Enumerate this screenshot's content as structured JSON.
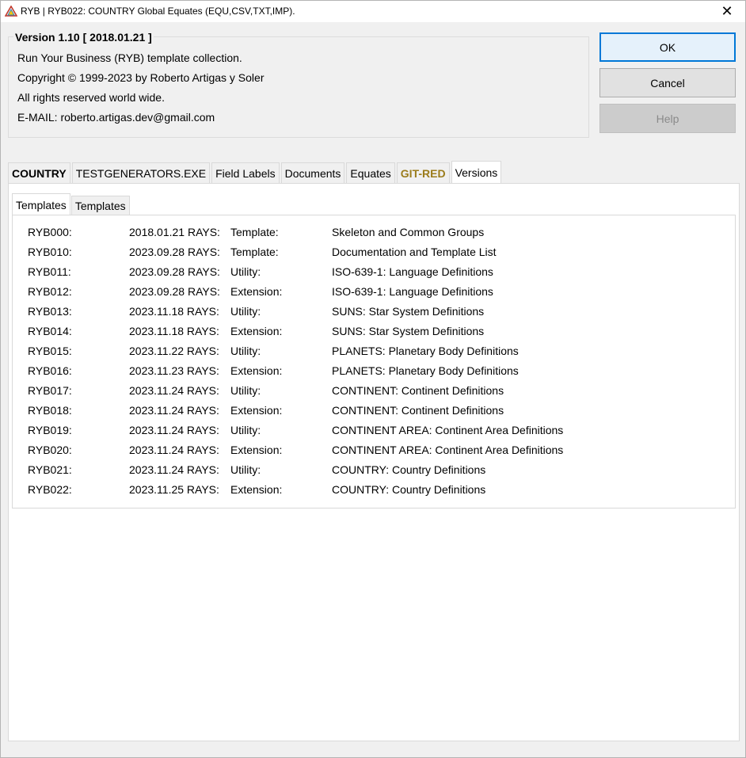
{
  "window": {
    "title": "RYB | RYB022: COUNTRY Global Equates (EQU,CSV,TXT,IMP).",
    "close_label": "✕"
  },
  "info": {
    "caption": "Version 1.10 [ 2018.01.21 ]",
    "lines": [
      "Run Your Business (RYB) template collection.",
      "Copyright © 1999-2023 by Roberto Artigas y Soler",
      "All rights reserved world wide.",
      "E-MAIL: roberto.artigas.dev@gmail.com"
    ]
  },
  "buttons": {
    "ok": "OK",
    "cancel": "Cancel",
    "help": "Help"
  },
  "tabs": [
    {
      "label": "COUNTRY"
    },
    {
      "label": "TESTGENERATORS.EXE"
    },
    {
      "label": "Field Labels"
    },
    {
      "label": "Documents"
    },
    {
      "label": "Equates"
    },
    {
      "label": "GIT-RED"
    },
    {
      "label": "Versions"
    }
  ],
  "subtabs": [
    {
      "label": "Templates"
    },
    {
      "label": "Templates"
    }
  ],
  "versions": [
    {
      "id": "RYB000:",
      "date": "2018.01.21 RAYS:",
      "type": "Template:",
      "desc": "Skeleton and Common Groups"
    },
    {
      "id": "RYB010:",
      "date": "2023.09.28 RAYS:",
      "type": "Template:",
      "desc": "Documentation and Template List"
    },
    {
      "id": "RYB011:",
      "date": "2023.09.28 RAYS:",
      "type": "Utility:",
      "desc": "ISO-639-1: Language Definitions"
    },
    {
      "id": "RYB012:",
      "date": "2023.09.28 RAYS:",
      "type": "Extension:",
      "desc": "ISO-639-1: Language Definitions"
    },
    {
      "id": "RYB013:",
      "date": "2023.11.18 RAYS:",
      "type": "Utility:",
      "desc": "SUNS: Star System Definitions"
    },
    {
      "id": "RYB014:",
      "date": "2023.11.18 RAYS:",
      "type": "Extension:",
      "desc": "SUNS: Star System Definitions"
    },
    {
      "id": "RYB015:",
      "date": "2023.11.22 RAYS:",
      "type": "Utility:",
      "desc": "PLANETS: Planetary Body Definitions"
    },
    {
      "id": "RYB016:",
      "date": "2023.11.23 RAYS:",
      "type": "Extension:",
      "desc": "PLANETS: Planetary Body Definitions"
    },
    {
      "id": "RYB017:",
      "date": "2023.11.24 RAYS:",
      "type": "Utility:",
      "desc": "CONTINENT: Continent Definitions"
    },
    {
      "id": "RYB018:",
      "date": "2023.11.24 RAYS:",
      "type": "Extension:",
      "desc": "CONTINENT: Continent Definitions"
    },
    {
      "id": "RYB019:",
      "date": "2023.11.24 RAYS:",
      "type": "Utility:",
      "desc": "CONTINENT AREA: Continent Area Definitions"
    },
    {
      "id": "RYB020:",
      "date": "2023.11.24 RAYS:",
      "type": "Extension:",
      "desc": "CONTINENT AREA: Continent Area Definitions"
    },
    {
      "id": "RYB021:",
      "date": "2023.11.24 RAYS:",
      "type": "Utility:",
      "desc": "COUNTRY: Country Definitions"
    },
    {
      "id": "RYB022:",
      "date": "2023.11.25 RAYS:",
      "type": "Extension:",
      "desc": "COUNTRY: Country Definitions"
    }
  ],
  "colors": {
    "accent": "#0078d7",
    "git_red_tab": "#9b7c1c"
  }
}
